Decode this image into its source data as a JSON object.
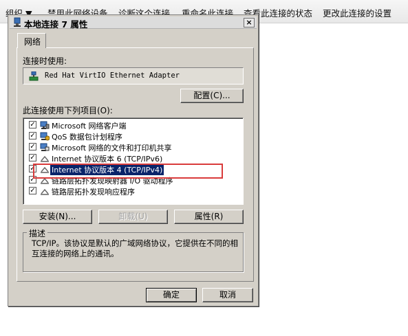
{
  "background": {
    "toolbar": [
      "组织 ▼",
      "禁用此网络设备",
      "诊断这个连接",
      "重命名此连接",
      "查看此连接的状态",
      "更改此连接的设置"
    ]
  },
  "dialog": {
    "title": "本地连接 7 属性",
    "close": "×",
    "tab": "网络",
    "connect_using_label": "连接时使用:",
    "adapter": "Red Hat VirtIO Ethernet Adapter",
    "configure_button": "配置(C)...",
    "items_label": "此连接使用下列项目(O):",
    "items": [
      {
        "label": "Microsoft 网络客户端",
        "checked": true,
        "icon": "network-client-icon"
      },
      {
        "label": "QoS 数据包计划程序",
        "checked": true,
        "icon": "qos-scheduler-icon"
      },
      {
        "label": "Microsoft 网络的文件和打印机共享",
        "checked": true,
        "icon": "file-printer-sharing-icon"
      },
      {
        "label": "Internet 协议版本 6 (TCP/IPv6)",
        "checked": true,
        "icon": "protocol-icon"
      },
      {
        "label": "Internet 协议版本 4 (TCP/IPv4)",
        "checked": true,
        "icon": "protocol-icon",
        "selected": true
      },
      {
        "label": "链路层拓扑发现映射器 I/O 驱动程序",
        "checked": true,
        "icon": "protocol-icon"
      },
      {
        "label": "链路层拓扑发现响应程序",
        "checked": true,
        "icon": "protocol-icon"
      }
    ],
    "install_button": "安装(N)...",
    "uninstall_button": "卸载(U)",
    "properties_button": "属性(R)",
    "description_title": "描述",
    "description": "TCP/IP。该协议是默认的广域网络协议，它提供在不同的相互连接的网络上的通讯。",
    "ok_button": "确定",
    "cancel_button": "取消",
    "colors": {
      "selection": "#0a246a",
      "highlight_box": "#d93a3a",
      "dialog_bg": "#d4d0c8"
    }
  }
}
